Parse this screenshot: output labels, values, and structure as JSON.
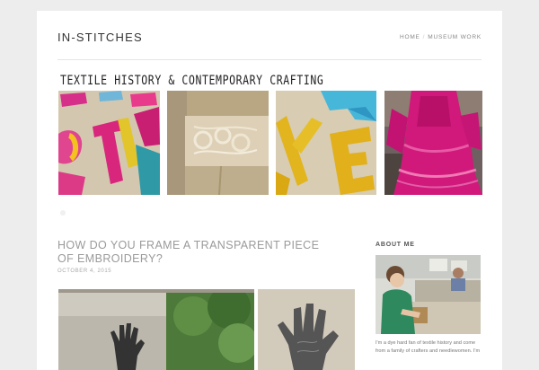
{
  "site": {
    "title": "IN-STITCHES"
  },
  "nav": {
    "items": [
      {
        "label": "HOME"
      },
      {
        "label": "MUSEUM WORK"
      }
    ]
  },
  "banner": {
    "title": "TEXTILE HISTORY & CONTEMPORARY CRAFTING",
    "images": [
      {
        "icon": "embroidered-letters-image"
      },
      {
        "icon": "whitework-embroidery-image"
      },
      {
        "icon": "yellow-letter-embroidery-image"
      },
      {
        "icon": "pink-victorian-dress-image"
      }
    ]
  },
  "post": {
    "title": "HOW DO YOU FRAME A TRANSPARENT PIECE OF EMBROIDERY?",
    "date": "OCTOBER 4, 2015"
  },
  "sidebar": {
    "about_title": "ABOUT ME",
    "about_text": "I'm a dye hard fan of textile history and come from a family of crafters and needlewomen. I'm"
  },
  "colors": {
    "accent": "#9a9a9a",
    "background": "#ededed",
    "card": "#ffffff"
  }
}
